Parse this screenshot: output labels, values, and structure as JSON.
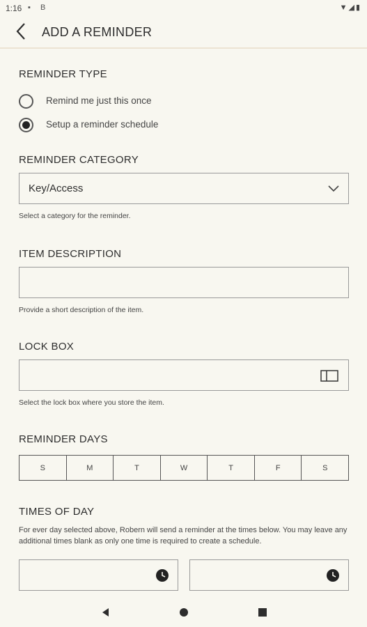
{
  "status_bar": {
    "time": "1:16",
    "notification_icons": [
      "sim-card-icon",
      "b-app-icon"
    ],
    "system_icons": [
      "wifi-icon",
      "signal-icon",
      "battery-icon"
    ]
  },
  "app_bar": {
    "title": "ADD A REMINDER"
  },
  "reminder_type": {
    "label": "REMINDER TYPE",
    "options": [
      {
        "label": "Remind me just this once",
        "selected": false
      },
      {
        "label": "Setup a reminder schedule",
        "selected": true
      }
    ]
  },
  "reminder_category": {
    "label": "REMINDER CATEGORY",
    "value": "Key/Access",
    "helper": "Select a category for the reminder."
  },
  "item_description": {
    "label": "ITEM DESCRIPTION",
    "value": "",
    "helper": "Provide a short description of the item."
  },
  "lock_box": {
    "label": "LOCK BOX",
    "value": "",
    "helper": "Select the lock box where you store the item."
  },
  "reminder_days": {
    "label": "REMINDER DAYS",
    "days": [
      "S",
      "M",
      "T",
      "W",
      "T",
      "F",
      "S"
    ]
  },
  "times_of_day": {
    "label": "TIMES OF DAY",
    "description": "For ever day selected above, Robern will send a reminder at the times below. You may leave any additional times blank as only one time is required to create a schedule.",
    "time1": "",
    "time2": ""
  },
  "colors": {
    "background": "#f8f7f0",
    "divider": "#ece3d3",
    "text": "#2d2d2d",
    "border": "#999999"
  }
}
